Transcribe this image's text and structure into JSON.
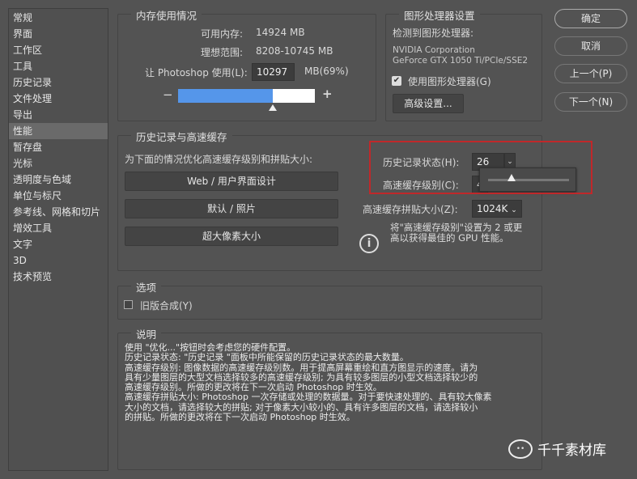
{
  "sidebar": {
    "items": [
      "常规",
      "界面",
      "工作区",
      "工具",
      "历史记录",
      "文件处理",
      "导出",
      "性能",
      "暂存盘",
      "光标",
      "透明度与色域",
      "单位与标尺",
      "参考线、网格和切片",
      "增效工具",
      "文字",
      "3D",
      "技术预览"
    ],
    "selected": "性能"
  },
  "memory": {
    "title": "内存使用情况",
    "available_label": "可用内存:",
    "available_value": "14924 MB",
    "ideal_label": "理想范围:",
    "ideal_value": "8208-10745 MB",
    "use_label": "让 Photoshop 使用(L):",
    "use_value": "10297",
    "use_unit": "MB(69%)",
    "percent": 69,
    "minus": "−",
    "plus": "+"
  },
  "gpu": {
    "title": "图形处理器设置",
    "detected_label": "检测到图形处理器:",
    "vendor": "NVIDIA Corporation",
    "model": "GeForce GTX 1050 Ti/PCIe/SSE2",
    "use_gpu_label": "使用图形处理器(G)",
    "use_gpu_checked": true,
    "advanced_button": "高级设置..."
  },
  "buttons": {
    "ok": "确定",
    "cancel": "取消",
    "prev": "上一个(P)",
    "next": "下一个(N)"
  },
  "history_cache": {
    "title": "历史记录与高速缓存",
    "optimize_label": "为下面的情况优化高速缓存级别和拼贴大小:",
    "btn_web": "Web / 用户界面设计",
    "btn_default": "默认 / 照片",
    "btn_huge": "超大像素大小",
    "history_states_label": "历史记录状态(H):",
    "history_states_value": "26",
    "cache_levels_label": "高速缓存级别(C):",
    "cache_levels_value": "4",
    "tile_size_label": "高速缓存拼贴大小(Z):",
    "tile_size_value": "1024K",
    "info": "将\"高速缓存级别\"设置为 2 或更高以获得最佳的 GPU 性能。",
    "highlight_color": "#c0282a"
  },
  "options": {
    "title": "选项",
    "legacy_label": "旧版合成(Y)",
    "legacy_checked": false
  },
  "description": {
    "title": "说明",
    "lines": [
      "使用 \"优化...\"按钮时会考虑您的硬件配置。",
      "历史记录状态: \"历史记录 \"面板中所能保留的历史记录状态的最大数量。",
      "高速缓存级别: 图像数据的高速缓存级别数。用于提高屏幕重绘和直方图显示的速度。请为",
      "具有少量图层的大型文档选择较多的高速缓存级别; 为具有较多图层的小型文档选择较少的",
      "高速缓存级别。所做的更改将在下一次启动 Photoshop 时生效。",
      "高速缓存拼贴大小: Photoshop 一次存储或处理的数据量。对于要快速处理的、具有较大像素",
      "大小的文档，请选择较大的拼贴; 对于像素大小较小的、具有许多图层的文档，请选择较小",
      "的拼贴。所做的更改将在下一次启动 Photoshop 时生效。"
    ]
  },
  "watermark": {
    "text": "千千素材库"
  }
}
